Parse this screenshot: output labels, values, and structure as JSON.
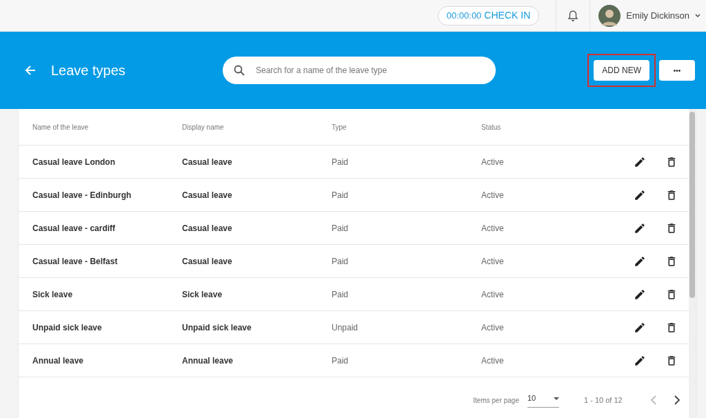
{
  "top_bar": {
    "timer": "00:00:00",
    "check_in": "CHECK IN",
    "user_name": "Emily Dickinson"
  },
  "header": {
    "title": "Leave types",
    "search": {
      "placeholder": "Search for a name of the leave type"
    },
    "add_button": {
      "label": "ADD NEW",
      "highlighted": true
    },
    "more_button": {
      "label": "•••"
    }
  },
  "table": {
    "columns": [
      "Name of the leave",
      "Display name",
      "Type",
      "Status"
    ],
    "rows": [
      {
        "name": "Casual leave London",
        "display_name": "Casual leave",
        "type": "Paid",
        "status": "Active"
      },
      {
        "name": "Casual leave - Edinburgh",
        "display_name": "Casual leave",
        "type": "Paid",
        "status": "Active"
      },
      {
        "name": "Casual leave - cardiff",
        "display_name": "Casual leave",
        "type": "Paid",
        "status": "Active"
      },
      {
        "name": "Casual leave - Belfast",
        "display_name": "Casual leave",
        "type": "Paid",
        "status": "Active"
      },
      {
        "name": "Sick leave",
        "display_name": "Sick leave",
        "type": "Paid",
        "status": "Active"
      },
      {
        "name": "Unpaid sick leave",
        "display_name": "Unpaid sick leave",
        "type": "Unpaid",
        "status": "Active"
      },
      {
        "name": "Annual leave",
        "display_name": "Annual leave",
        "type": "Paid",
        "status": "Active"
      }
    ]
  },
  "pagination": {
    "items_per_page_label": "Items per page",
    "items_per_page": "10",
    "range": "1 - 10 of 12",
    "prev_disabled": true,
    "next_disabled": false
  }
}
